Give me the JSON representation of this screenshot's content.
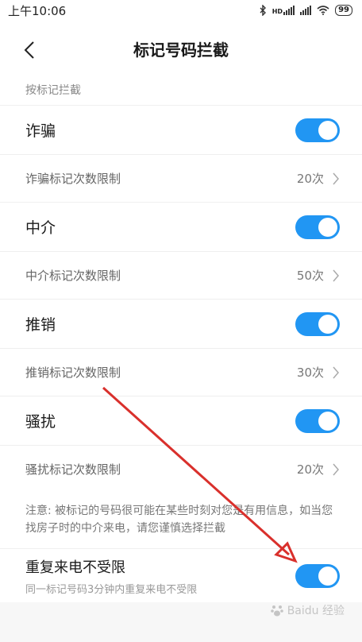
{
  "status": {
    "time": "上午10:06",
    "signal1_label": "HD",
    "battery": "99"
  },
  "header": {
    "title": "标记号码拦截"
  },
  "section_label": "按标记拦截",
  "categories": [
    {
      "name": "诈骗",
      "enabled": true,
      "limit_label": "诈骗标记次数限制",
      "limit_value": "20次"
    },
    {
      "name": "中介",
      "enabled": true,
      "limit_label": "中介标记次数限制",
      "limit_value": "50次"
    },
    {
      "name": "推销",
      "enabled": true,
      "limit_label": "推销标记次数限制",
      "limit_value": "30次"
    },
    {
      "name": "骚扰",
      "enabled": true,
      "limit_label": "骚扰标记次数限制",
      "limit_value": "20次"
    }
  ],
  "note": "注意: 被标记的号码很可能在某些时刻对您是有用信息，如当您找房子时的中介来电，请您谨慎选择拦截",
  "repeat_call": {
    "title": "重复来电不受限",
    "subtitle": "同一标记号码3分钟内重复来电不受限",
    "enabled": true
  },
  "watermark": "Baidu 经验",
  "colors": {
    "accent": "#2196f3",
    "arrow": "#d9302c"
  }
}
